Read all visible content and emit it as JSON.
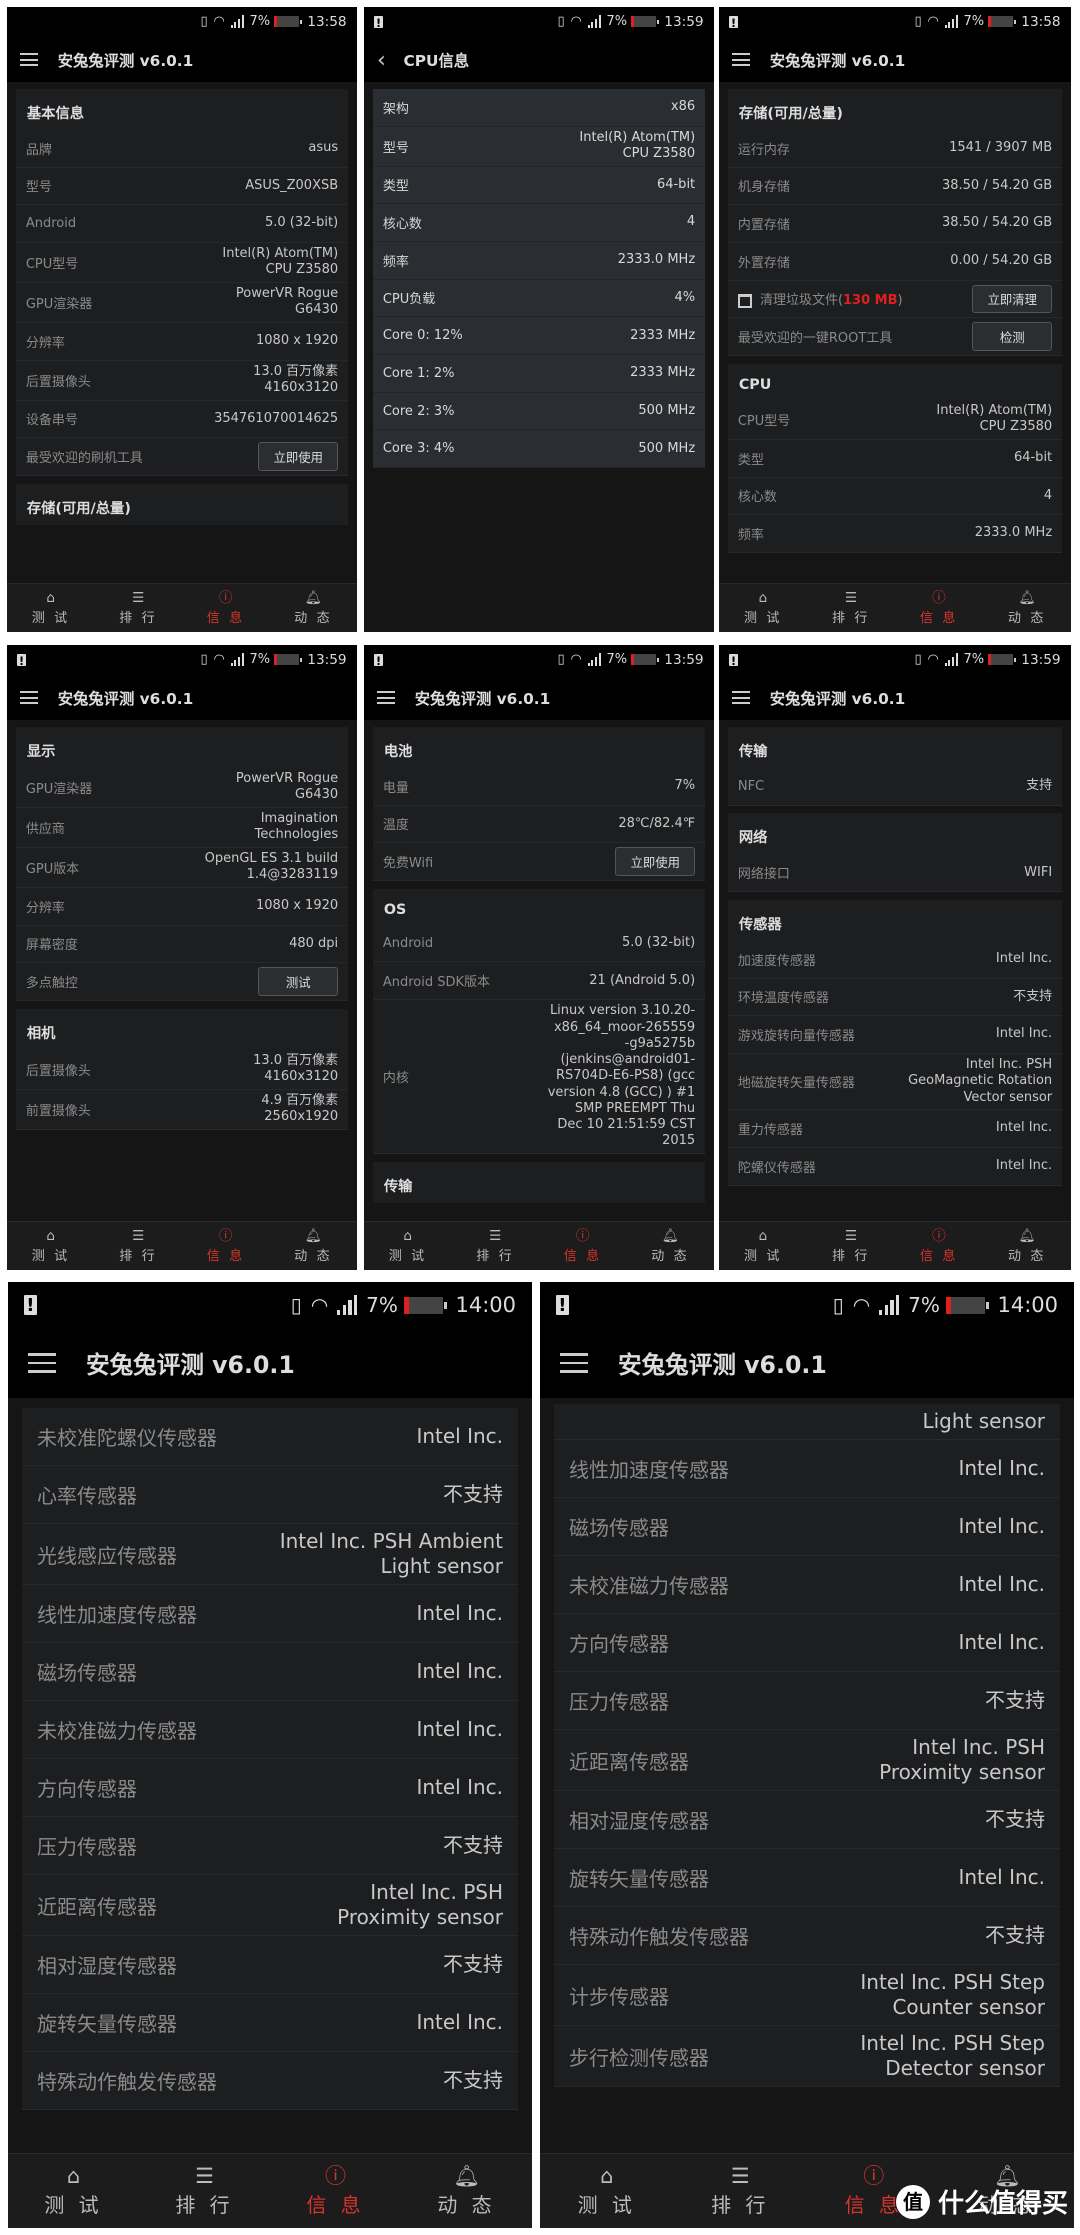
{
  "app_title": "安兔兔评测 v6.0.1",
  "battery_text": "7%",
  "accent_color": "#d8342c",
  "highlight_color": "#e0201e",
  "nav": [
    {
      "label": "测 试",
      "icon": "home-icon"
    },
    {
      "label": "排 行",
      "icon": "list-icon"
    },
    {
      "label": "信 息",
      "icon": "alert-circle-icon",
      "active": true
    },
    {
      "label": "动 态",
      "icon": "bell-icon"
    }
  ],
  "watermark": {
    "badge": "值",
    "text": "什么值得买"
  },
  "panels": [
    {
      "time": "13:58",
      "warn": false,
      "header": "menu",
      "title": "安兔兔评测 v6.0.1",
      "nav": true,
      "sections": [
        {
          "heading": "基本信息",
          "rows": [
            {
              "label": "品牌",
              "value": "asus"
            },
            {
              "label": "型号",
              "value": "ASUS_Z00XSB"
            },
            {
              "label": "Android",
              "value": "5.0 (32-bit)"
            },
            {
              "label": "CPU型号",
              "value": "Intel(R) Atom(TM)\nCPU  Z3580"
            },
            {
              "label": "GPU渲染器",
              "value": "PowerVR Rogue\nG6430"
            },
            {
              "label": "分辨率",
              "value": "1080 x 1920"
            },
            {
              "label": "后置摄像头",
              "value": "13.0 百万像素\n4160x3120"
            },
            {
              "label": "设备串号",
              "value": "354761070014625"
            },
            {
              "label": "最受欢迎的刷机工具",
              "button": "立即使用"
            }
          ]
        },
        {
          "heading": "存储(可用/总量)",
          "rows": []
        }
      ]
    },
    {
      "time": "13:59",
      "warn": true,
      "header": "back",
      "title": "CPU信息",
      "nav": false,
      "sections": [
        {
          "style": "light",
          "rows": [
            {
              "label": "架构",
              "value": "x86"
            },
            {
              "label": "型号",
              "value": "Intel(R) Atom(TM)\nCPU  Z3580"
            },
            {
              "label": "类型",
              "value": "64-bit"
            },
            {
              "label": "核心数",
              "value": "4"
            },
            {
              "label": "频率",
              "value": "2333.0 MHz"
            },
            {
              "label": "CPU负载",
              "value": "4%"
            },
            {
              "label": "Core 0: 12%",
              "value": "2333 MHz"
            },
            {
              "label": "Core 1: 2%",
              "value": "2333 MHz"
            },
            {
              "label": "Core 2: 3%",
              "value": "500 MHz"
            },
            {
              "label": "Core 3: 4%",
              "value": "500 MHz"
            }
          ]
        }
      ]
    },
    {
      "time": "13:58",
      "warn": true,
      "header": "menu",
      "title": "安兔兔评测 v6.0.1",
      "nav": true,
      "sections": [
        {
          "heading": "存储(可用/总量)",
          "rows": [
            {
              "label": "运行内存",
              "value": "1541 / 3907 MB"
            },
            {
              "label": "机身存储",
              "value": "38.50 / 54.20 GB"
            },
            {
              "label": "内置存储",
              "value": "38.50 / 54.20 GB"
            },
            {
              "label": "外置存储",
              "value": "0.00 / 54.20 GB"
            },
            {
              "label": "清理垃圾文件(",
              "highlight": "130 MB",
              "suffix": ")",
              "trash": true,
              "button": "立即清理"
            },
            {
              "label": "最受欢迎的一键ROOT工具",
              "button": "检测"
            }
          ]
        },
        {
          "heading": "CPU",
          "rows": [
            {
              "label": "CPU型号",
              "value": "Intel(R) Atom(TM)\nCPU  Z3580"
            },
            {
              "label": "类型",
              "value": "64-bit"
            },
            {
              "label": "核心数",
              "value": "4"
            },
            {
              "label": "频率",
              "value": "2333.0 MHz"
            }
          ]
        }
      ]
    },
    {
      "time": "13:59",
      "warn": true,
      "header": "menu",
      "title": "安兔兔评测 v6.0.1",
      "nav": true,
      "sections": [
        {
          "heading": "显示",
          "rows": [
            {
              "label": "GPU渲染器",
              "value": "PowerVR Rogue\nG6430"
            },
            {
              "label": "供应商",
              "value": "Imagination\nTechnologies"
            },
            {
              "label": "GPU版本",
              "value": "OpenGL ES 3.1 build\n1.4@3283119"
            },
            {
              "label": "分辨率",
              "value": "1080 x 1920"
            },
            {
              "label": "屏幕密度",
              "value": "480 dpi"
            },
            {
              "label": "多点触控",
              "button": "测试"
            }
          ]
        },
        {
          "heading": "相机",
          "rows": [
            {
              "label": "后置摄像头",
              "value": "13.0 百万像素\n4160x3120"
            },
            {
              "label": "前置摄像头",
              "value": "4.9 百万像素\n2560x1920"
            }
          ]
        }
      ]
    },
    {
      "time": "13:59",
      "warn": true,
      "header": "menu",
      "title": "安兔兔评测 v6.0.1",
      "nav": true,
      "sections": [
        {
          "heading": "电池",
          "rows": [
            {
              "label": "电量",
              "value": "7%"
            },
            {
              "label": "温度",
              "value": "28℃/82.4℉"
            },
            {
              "label": "免费Wifi",
              "button": "立即使用"
            }
          ]
        },
        {
          "heading": "OS",
          "rows": [
            {
              "label": "Android",
              "value": "5.0 (32-bit)"
            },
            {
              "label": "Android SDK版本",
              "value": "21  (Android 5.0)"
            },
            {
              "label": "内核",
              "value": "Linux version 3.10.20-\nx86_64_moor-265559\n-g9a5275b\n(jenkins@android01-\nRS704D-E6-PS8) (gcc\nversion 4.8 (GCC) ) #1\nSMP PREEMPT Thu\nDec 10 21:51:59 CST\n2015"
            }
          ]
        },
        {
          "heading": "传输",
          "rows": []
        }
      ]
    },
    {
      "time": "13:59",
      "warn": true,
      "header": "menu",
      "title": "安兔兔评测 v6.0.1",
      "nav": true,
      "sections": [
        {
          "heading": "传输",
          "rows": [
            {
              "label": "NFC",
              "value": "支持"
            }
          ]
        },
        {
          "heading": "网络",
          "rows": [
            {
              "label": "网络接口",
              "value": "WIFI"
            }
          ]
        },
        {
          "heading": "传感器",
          "rows": [
            {
              "label": "加速度传感器",
              "value": "Intel Inc."
            },
            {
              "label": "环境温度传感器",
              "value": "不支持"
            },
            {
              "label": "游戏旋转向量传感器",
              "value": "Intel Inc."
            },
            {
              "label": "地磁旋转矢量传感器",
              "value": "Intel Inc. PSH\nGeoMagnetic Rotation\nVector sensor"
            },
            {
              "label": "重力传感器",
              "value": "Intel Inc."
            },
            {
              "label": "陀螺仪传感器",
              "value": "Intel Inc."
            }
          ]
        }
      ]
    },
    {
      "time": "14:00",
      "warn": true,
      "header": "menu",
      "title": "安兔兔评测 v6.0.1",
      "nav": true,
      "sections": [
        {
          "rows": [
            {
              "label": "未校准陀螺仪传感器",
              "value": "Intel Inc."
            },
            {
              "label": "心率传感器",
              "value": "不支持"
            },
            {
              "label": "光线感应传感器",
              "value": "Intel Inc. PSH Ambient\nLight sensor"
            },
            {
              "label": "线性加速度传感器",
              "value": "Intel Inc."
            },
            {
              "label": "磁场传感器",
              "value": "Intel Inc."
            },
            {
              "label": "未校准磁力传感器",
              "value": "Intel Inc."
            },
            {
              "label": "方向传感器",
              "value": "Intel Inc."
            },
            {
              "label": "压力传感器",
              "value": "不支持"
            },
            {
              "label": "近距离传感器",
              "value": "Intel Inc. PSH\nProximity sensor"
            },
            {
              "label": "相对湿度传感器",
              "value": "不支持"
            },
            {
              "label": "旋转矢量传感器",
              "value": "Intel Inc."
            },
            {
              "label": "特殊动作触发传感器",
              "value": "不支持"
            }
          ]
        }
      ]
    },
    {
      "time": "14:00",
      "warn": true,
      "header": "menu",
      "title": "安兔兔评测 v6.0.1",
      "nav": true,
      "sections": [
        {
          "rows": [
            {
              "label": "",
              "value": "Light sensor",
              "partial": true
            },
            {
              "label": "线性加速度传感器",
              "value": "Intel Inc."
            },
            {
              "label": "磁场传感器",
              "value": "Intel Inc."
            },
            {
              "label": "未校准磁力传感器",
              "value": "Intel Inc."
            },
            {
              "label": "方向传感器",
              "value": "Intel Inc."
            },
            {
              "label": "压力传感器",
              "value": "不支持"
            },
            {
              "label": "近距离传感器",
              "value": "Intel Inc. PSH\nProximity sensor"
            },
            {
              "label": "相对湿度传感器",
              "value": "不支持"
            },
            {
              "label": "旋转矢量传感器",
              "value": "Intel Inc."
            },
            {
              "label": "特殊动作触发传感器",
              "value": "不支持"
            },
            {
              "label": "计步传感器",
              "value": "Intel Inc. PSH Step\nCounter sensor"
            },
            {
              "label": "步行检测传感器",
              "value": "Intel Inc. PSH Step\nDetector sensor"
            }
          ]
        }
      ]
    }
  ]
}
